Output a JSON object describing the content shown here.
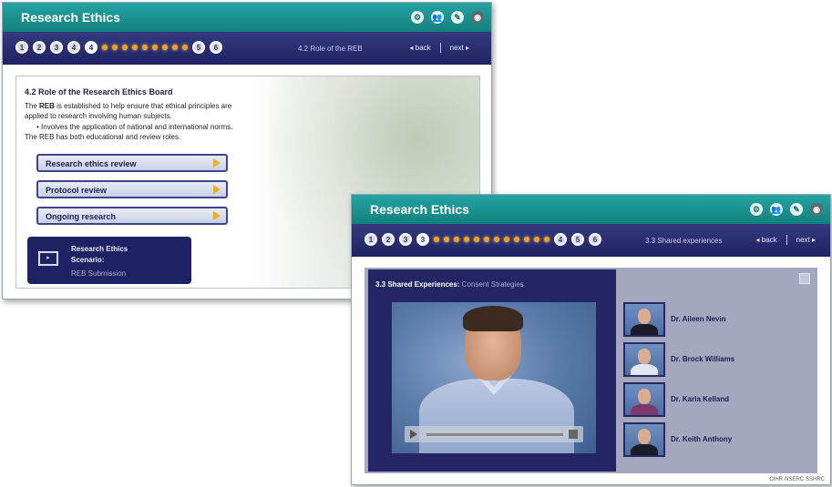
{
  "window1": {
    "title": "Research Ethics",
    "icons": [
      "gear-icon",
      "people-icon",
      "help-icon",
      "audio-icon"
    ],
    "progress": {
      "labels_before": [
        "1",
        "2",
        "3",
        "4",
        "4"
      ],
      "pips": 9,
      "labels_after": [
        "5",
        "6"
      ]
    },
    "breadcrumb": "4.2 Role of the REB",
    "back_label": "◂ back",
    "next_label": "next ▸",
    "section_title": "4.2 Role of the Research Ethics Board",
    "para1_pre": "The ",
    "para1_bold": "REB",
    "para1_post": " is established to help ensure that ethical principles are",
    "para1_line2": "applied to research involving human subjects.",
    "bullet": "• Involves the application of national and international norms.",
    "para2": "The REB has both educational and review roles.",
    "buttons": [
      "Research ethics review",
      "Protocol review",
      "Ongoing research"
    ],
    "scenario": {
      "line1": "Research Ethics",
      "line2": "Scenario:",
      "subtitle": "REB Submission"
    }
  },
  "window2": {
    "title": "Research Ethics",
    "icons": [
      "gear-icon",
      "people-icon",
      "help-icon",
      "audio-icon"
    ],
    "progress": {
      "labels_before": [
        "1",
        "2",
        "3",
        "3"
      ],
      "pips": 12,
      "labels_after": [
        "4",
        "5",
        "6"
      ]
    },
    "breadcrumb": "3.3 Shared experiences",
    "back_label": "◂ back",
    "next_label": "next ▸",
    "panel_title_bold": "3.3 Shared Experiences:",
    "panel_title_light": " Consent Strategies",
    "people": [
      {
        "name": "Dr. Aileen Nevin",
        "hair": "#1a1a1a",
        "shirt": "#1b1b28"
      },
      {
        "name": "Dr. Brock Williams",
        "hair": "#3a2a1f",
        "shirt": "#e0e6f2"
      },
      {
        "name": "Dr. Karla Kelland",
        "hair": "#4a2a20",
        "shirt": "#7a3a6a"
      },
      {
        "name": "Dr. Keith Anthony",
        "hair": "#e8e0d8",
        "shirt": "#1b1b28"
      }
    ],
    "footer": "CIHR·NSERC·SSHRC"
  }
}
